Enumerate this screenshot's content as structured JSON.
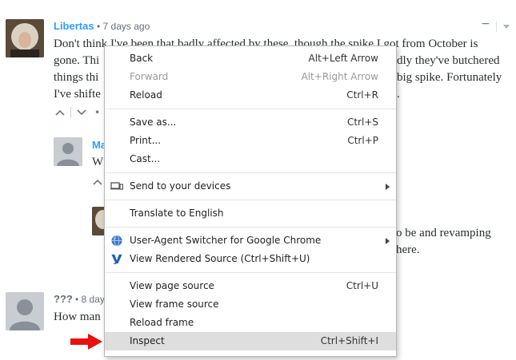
{
  "thread": {
    "c1_author": "Libertas",
    "c1_meta": "• 7 days ago",
    "c1_lines": [
      "Don't think I've been that badly affected by these, though the spike I got from October is",
      "gone. Thi",
      "things thi",
      "I've shifte"
    ],
    "c1_lines_right": [
      "",
      "",
      "dly they've butchered",
      "big spike. Fortunately",
      "."
    ],
    "c2_author": "Ma",
    "c2_text": "W",
    "c3_right_1": "o be and revamping",
    "c3_right_2": "here.",
    "c4_author": "???",
    "c4_meta": "• 8 day",
    "c4_text": "How man",
    "collapse_minus": "−"
  },
  "menu": {
    "groups": [
      [
        {
          "label": "Back",
          "shortcut": "Alt+Left Arrow",
          "disabled": false
        },
        {
          "label": "Forward",
          "shortcut": "Alt+Right Arrow",
          "disabled": true
        },
        {
          "label": "Reload",
          "shortcut": "Ctrl+R",
          "disabled": false
        }
      ],
      [
        {
          "label": "Save as...",
          "shortcut": "Ctrl+S"
        },
        {
          "label": "Print...",
          "shortcut": "Ctrl+P"
        },
        {
          "label": "Cast..."
        }
      ],
      [
        {
          "label": "Send to your devices",
          "icon": "devices-icon",
          "submenu": true
        }
      ],
      [
        {
          "label": "Translate to English"
        }
      ],
      [
        {
          "label": "User-Agent Switcher for Google Chrome",
          "icon": "globe-icon",
          "submenu": true
        },
        {
          "label": "View Rendered Source (Ctrl+Shift+U)",
          "icon": "vrs-icon"
        }
      ],
      [
        {
          "label": "View page source",
          "shortcut": "Ctrl+U"
        },
        {
          "label": "View frame source"
        },
        {
          "label": "Reload frame"
        },
        {
          "label": "Inspect",
          "shortcut": "Ctrl+Shift+I",
          "highlighted": true
        }
      ]
    ]
  },
  "colors": {
    "link_blue": "#2e9fff",
    "arrow_red": "#e8110f",
    "highlight": "#dedede"
  }
}
